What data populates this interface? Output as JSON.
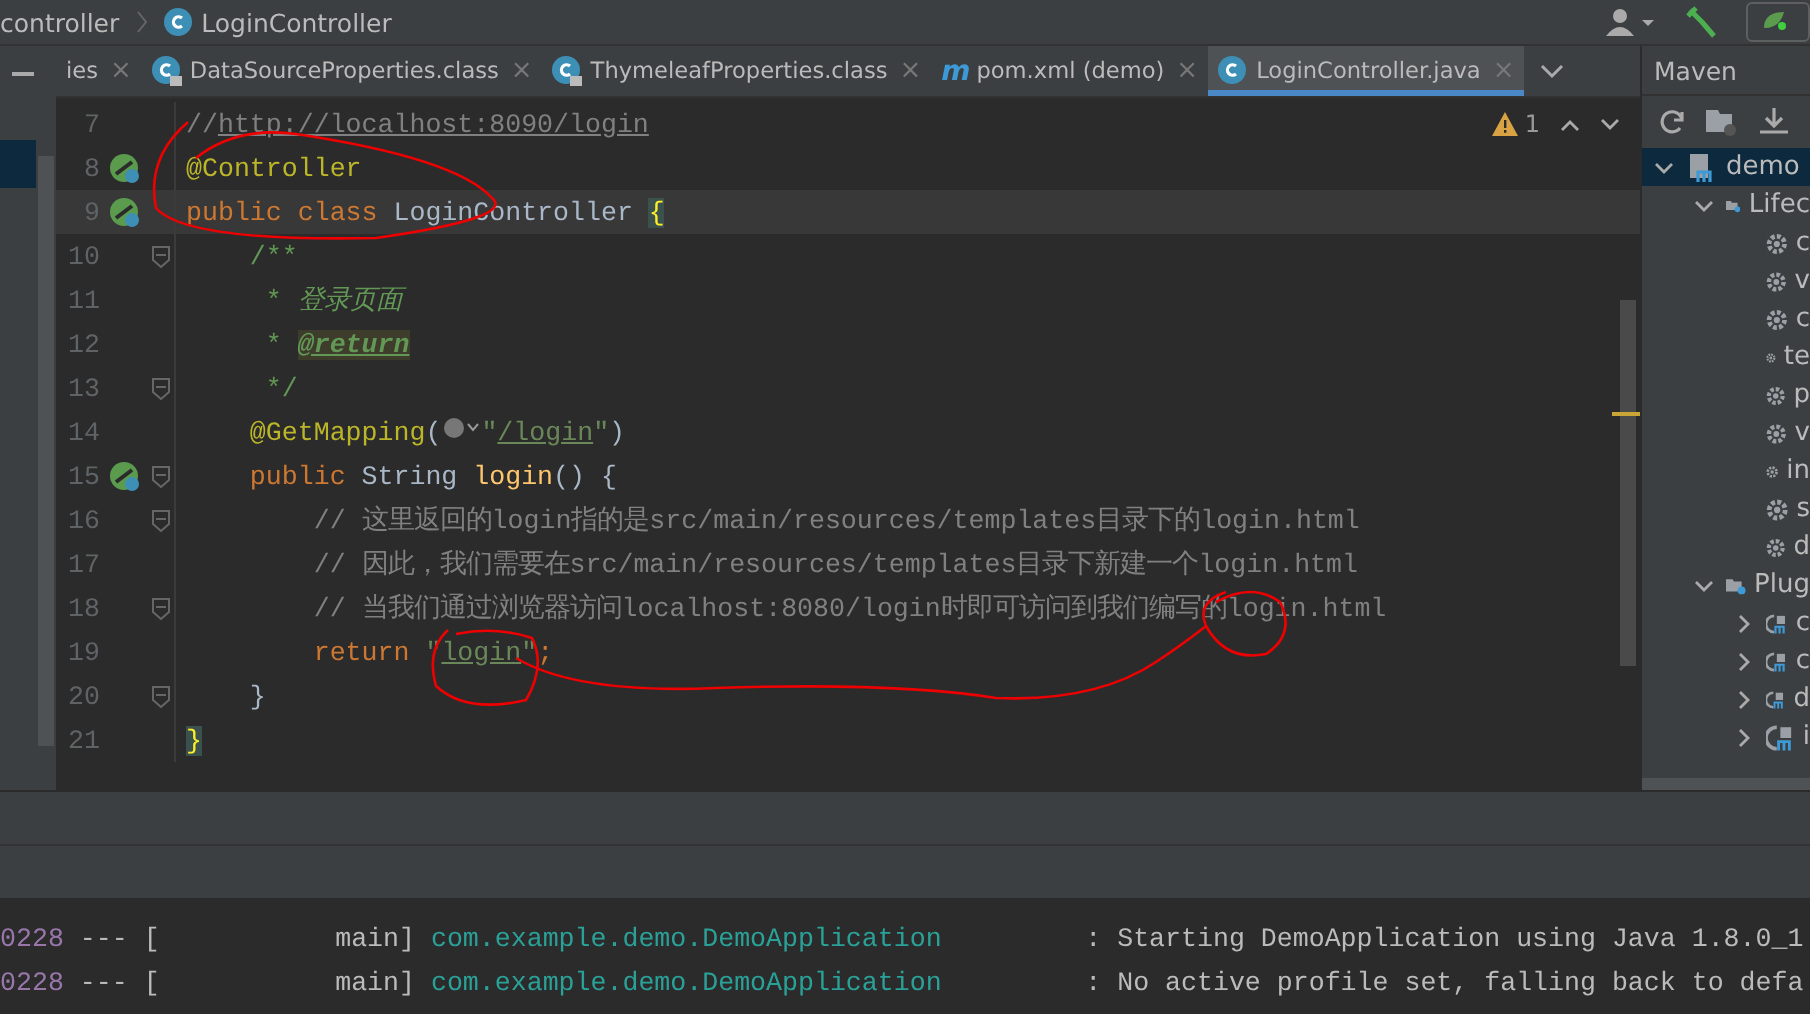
{
  "breadcrumb": {
    "items": [
      {
        "label": "controller",
        "kind": "package"
      },
      {
        "label": "LoginController",
        "kind": "class"
      }
    ]
  },
  "tabs": [
    {
      "label": "ies",
      "kind": "plain",
      "close": "×",
      "selected": false
    },
    {
      "label": "DataSourceProperties.class",
      "kind": "locked-class",
      "close": "×",
      "selected": false
    },
    {
      "label": "ThymeleafProperties.class",
      "kind": "locked-class",
      "close": "×",
      "selected": false
    },
    {
      "label": "pom.xml (demo)",
      "kind": "maven",
      "badge": "m",
      "close": "×",
      "selected": false
    },
    {
      "label": "LoginController.java",
      "kind": "class",
      "close": "×",
      "selected": true
    }
  ],
  "inspection": {
    "count": "1"
  },
  "editor": {
    "lines": [
      {
        "number": "7",
        "current": false,
        "bean": false,
        "fold": false,
        "tokens": [
          {
            "kind": "comment",
            "text": "//"
          },
          {
            "kind": "commentlink",
            "text": "http://localhost:8090/login"
          }
        ]
      },
      {
        "number": "8",
        "current": false,
        "bean": true,
        "fold": false,
        "tokens": [
          {
            "kind": "annotation",
            "text": "@Controller"
          }
        ]
      },
      {
        "number": "9",
        "current": true,
        "bean": true,
        "fold": false,
        "tokens": [
          {
            "kind": "keyword",
            "text": "public class "
          },
          {
            "kind": "plain",
            "text": "LoginController "
          },
          {
            "kind": "brace",
            "text": "{"
          }
        ]
      },
      {
        "number": "10",
        "current": false,
        "bean": false,
        "fold": true,
        "tokens": [
          {
            "kind": "doc",
            "text": "    /**"
          }
        ]
      },
      {
        "number": "11",
        "current": false,
        "bean": false,
        "fold": false,
        "tokens": [
          {
            "kind": "doc",
            "text": "     * "
          },
          {
            "kind": "docitalic",
            "text": "登录页面"
          }
        ]
      },
      {
        "number": "12",
        "current": false,
        "bean": false,
        "fold": false,
        "tokens": [
          {
            "kind": "doc",
            "text": "     * "
          },
          {
            "kind": "doctag",
            "text": "@return"
          }
        ]
      },
      {
        "number": "13",
        "current": false,
        "bean": false,
        "fold": true,
        "tokens": [
          {
            "kind": "doc",
            "text": "     */"
          }
        ]
      },
      {
        "number": "14",
        "current": false,
        "bean": false,
        "fold": false,
        "tokens": [
          {
            "kind": "annotation",
            "text": "    @GetMapping"
          },
          {
            "kind": "plain",
            "text": "("
          },
          {
            "kind": "globe"
          },
          {
            "kind": "string",
            "text": "\""
          },
          {
            "kind": "stringlink",
            "text": "/login"
          },
          {
            "kind": "string",
            "text": "\""
          },
          {
            "kind": "plain",
            "text": ")"
          }
        ]
      },
      {
        "number": "15",
        "current": false,
        "bean": true,
        "fold": true,
        "tokens": [
          {
            "kind": "keyword",
            "text": "    public "
          },
          {
            "kind": "plain",
            "text": "String "
          },
          {
            "kind": "method",
            "text": "login"
          },
          {
            "kind": "plain",
            "text": "() {"
          }
        ]
      },
      {
        "number": "16",
        "current": false,
        "bean": false,
        "fold": true,
        "tokens": [
          {
            "kind": "comment",
            "text": "        // 这里返回的login指的是src/main/resources/templates目录下的login.html"
          }
        ]
      },
      {
        "number": "17",
        "current": false,
        "bean": false,
        "fold": false,
        "tokens": [
          {
            "kind": "comment",
            "text": "        // 因此，我们需要在src/main/resources/templates目录下新建一个login.html"
          }
        ]
      },
      {
        "number": "18",
        "current": false,
        "bean": false,
        "fold": true,
        "tokens": [
          {
            "kind": "comment",
            "text": "        // 当我们通过浏览器访问localhost:8080/login时即可访问到我们编写的login.html"
          }
        ]
      },
      {
        "number": "19",
        "current": false,
        "bean": false,
        "fold": false,
        "tokens": [
          {
            "kind": "keyword",
            "text": "        return "
          },
          {
            "kind": "string",
            "text": "\""
          },
          {
            "kind": "stringlink",
            "text": "login"
          },
          {
            "kind": "string",
            "text": "\""
          },
          {
            "kind": "keyword",
            "text": ";"
          }
        ]
      },
      {
        "number": "20",
        "current": false,
        "bean": false,
        "fold": true,
        "tokens": [
          {
            "kind": "plain",
            "text": "    }"
          }
        ]
      },
      {
        "number": "21",
        "current": false,
        "bean": false,
        "fold": false,
        "tokens": [
          {
            "kind": "brace",
            "text": "}"
          }
        ]
      }
    ]
  },
  "maven": {
    "title": "Maven",
    "tree": [
      {
        "label": "demo",
        "kind": "project",
        "expanded": true,
        "selected": true,
        "children": [
          {
            "label": "Lifec",
            "kind": "folder",
            "expanded": true,
            "selected": false,
            "children": [
              {
                "label": "c",
                "kind": "goal",
                "selected": false
              },
              {
                "label": "v",
                "kind": "goal",
                "selected": false
              },
              {
                "label": "c",
                "kind": "goal",
                "selected": false
              },
              {
                "label": "te",
                "kind": "goal",
                "selected": false
              },
              {
                "label": "p",
                "kind": "goal",
                "selected": false
              },
              {
                "label": "v",
                "kind": "goal",
                "selected": false
              },
              {
                "label": "in",
                "kind": "goal",
                "selected": false
              },
              {
                "label": "s",
                "kind": "goal",
                "selected": false
              },
              {
                "label": "d",
                "kind": "goal",
                "selected": false
              }
            ]
          },
          {
            "label": "Plug",
            "kind": "folder",
            "expanded": true,
            "selected": false,
            "children": [
              {
                "label": "c",
                "kind": "plugin",
                "expanded": false,
                "selected": false
              },
              {
                "label": "c",
                "kind": "plugin",
                "expanded": false,
                "selected": false
              },
              {
                "label": "d",
                "kind": "plugin",
                "expanded": false,
                "selected": false
              },
              {
                "label": "i",
                "kind": "plugin",
                "expanded": false,
                "selected": false
              }
            ]
          }
        ]
      }
    ]
  },
  "console": {
    "lines": [
      {
        "pid": "0228",
        "sep": "--- [",
        "thread": "           main]",
        "logger": "com.example.demo.DemoApplication",
        "message": "         : Starting DemoApplication using Java 1.8.0_1"
      },
      {
        "pid": "0228",
        "sep": "--- [",
        "thread": "           main]",
        "logger": "com.example.demo.DemoApplication",
        "message": "         : No active profile set, falling back to defa"
      }
    ]
  }
}
